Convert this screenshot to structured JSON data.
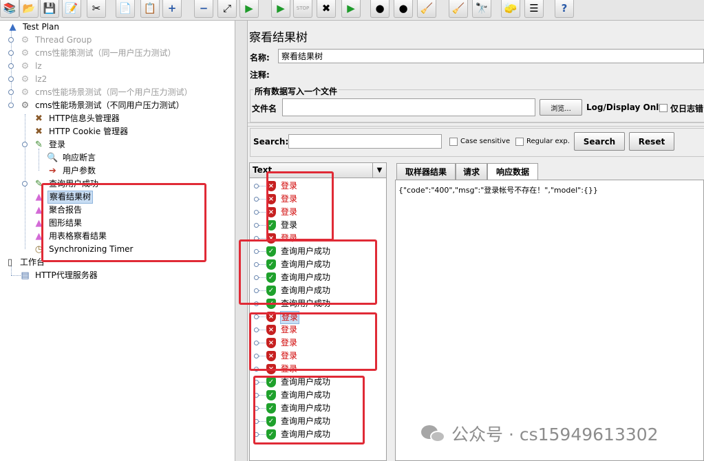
{
  "toolbar": {
    "buttons": [
      {
        "icon": "templates-icon",
        "glyph": "📚"
      },
      {
        "icon": "open-icon",
        "glyph": "📂"
      },
      {
        "icon": "save-icon",
        "glyph": "💾"
      },
      {
        "icon": "save-as-icon",
        "glyph": "📝"
      },
      {
        "icon": "cut-icon",
        "glyph": "✂"
      },
      {
        "icon": "copy-icon",
        "glyph": "📄"
      },
      {
        "icon": "paste-icon",
        "glyph": "📋"
      },
      {
        "icon": "expand-icon",
        "glyph": "+"
      },
      {
        "icon": "collapse-icon",
        "glyph": "−"
      },
      {
        "icon": "toggle-icon",
        "glyph": "⤢"
      },
      {
        "icon": "start-icon",
        "glyph": "▶"
      },
      {
        "icon": "start-no-pause-icon",
        "glyph": "▶"
      },
      {
        "icon": "stop-icon",
        "glyph": "STOP"
      },
      {
        "icon": "shutdown-icon",
        "glyph": "✖"
      },
      {
        "icon": "remote-start-icon",
        "glyph": "▶"
      },
      {
        "icon": "remote-stop-icon",
        "glyph": "●"
      },
      {
        "icon": "remote-shutdown-icon",
        "glyph": "●"
      },
      {
        "icon": "clear-icon",
        "glyph": "🧹"
      },
      {
        "icon": "clear-all-icon",
        "glyph": "🧹"
      },
      {
        "icon": "search-icon",
        "glyph": "🔭"
      },
      {
        "icon": "reset-search-icon",
        "glyph": "🧽"
      },
      {
        "icon": "function-helper-icon",
        "glyph": "☰"
      },
      {
        "icon": "help-icon",
        "glyph": "?"
      }
    ]
  },
  "tree": {
    "test_plan": "Test Plan",
    "thread_group": "Thread Group",
    "cms_strategy": "cms性能策测试（同一用户压力测试）",
    "lz": "lz",
    "lz2": "lz2",
    "cms_scenario_same": "cms性能场景测试（同一个用户压力测试）",
    "cms_scenario_diff": "cms性能场景测试（不同用户压力测试）",
    "http_header_manager": "HTTP信息头管理器",
    "http_cookie_manager": "HTTP Cookie 管理器",
    "login": "登录",
    "response_assertion": "响应断言",
    "user_parameters": "用户参数",
    "query_user_success": "查询用户成功",
    "view_results_tree": "察看结果树",
    "aggregate_report": "聚合报告",
    "graph_results": "图形结果",
    "view_results_table": "用表格察看结果",
    "sync_timer": "Synchronizing Timer",
    "workbench": "工作台",
    "http_proxy_server": "HTTP代理服务器"
  },
  "panel": {
    "title": "察看结果树",
    "name_label": "名称:",
    "name_value": "察看结果树",
    "comment_label": "注释:",
    "comment_value": "",
    "write_all_to_file": "所有数据写入一个文件",
    "filename_label": "文件名",
    "filename_value": "",
    "browse_button": "浏览...",
    "log_display_only": "Log/Display Only:",
    "errors_only": "仅日志错",
    "search_label": "Search:",
    "search_value": "",
    "case_sensitive": "Case sensitive",
    "regular_exp": "Regular exp.",
    "search_button": "Search",
    "reset_button": "Reset",
    "renderer": "Text"
  },
  "results": [
    {
      "label": "登录",
      "status": "fail"
    },
    {
      "label": "登录",
      "status": "fail"
    },
    {
      "label": "登录",
      "status": "fail"
    },
    {
      "label": "登录",
      "status": "ok"
    },
    {
      "label": "登录",
      "status": "fail"
    },
    {
      "label": "查询用户成功",
      "status": "ok"
    },
    {
      "label": "查询用户成功",
      "status": "ok"
    },
    {
      "label": "查询用户成功",
      "status": "ok"
    },
    {
      "label": "查询用户成功",
      "status": "ok"
    },
    {
      "label": "查询用户成功",
      "status": "ok"
    },
    {
      "label": "登录",
      "status": "fail",
      "selected": true
    },
    {
      "label": "登录",
      "status": "fail"
    },
    {
      "label": "登录",
      "status": "fail"
    },
    {
      "label": "登录",
      "status": "fail"
    },
    {
      "label": "登录",
      "status": "fail"
    },
    {
      "label": "查询用户成功",
      "status": "ok"
    },
    {
      "label": "查询用户成功",
      "status": "ok"
    },
    {
      "label": "查询用户成功",
      "status": "ok"
    },
    {
      "label": "查询用户成功",
      "status": "ok"
    },
    {
      "label": "查询用户成功",
      "status": "ok"
    }
  ],
  "tabs": [
    "取样器结果",
    "请求",
    "响应数据"
  ],
  "response_text": "{\"code\":\"400\",\"msg\":\"登录帐号不存在！\",\"model\":{}}",
  "watermark": {
    "text": "公众号 · cs15949613302"
  },
  "colors": {
    "annotation": "#e02a36",
    "fail": "#c62020",
    "ok": "#1fa12c",
    "selection": "#c8ddf3"
  }
}
